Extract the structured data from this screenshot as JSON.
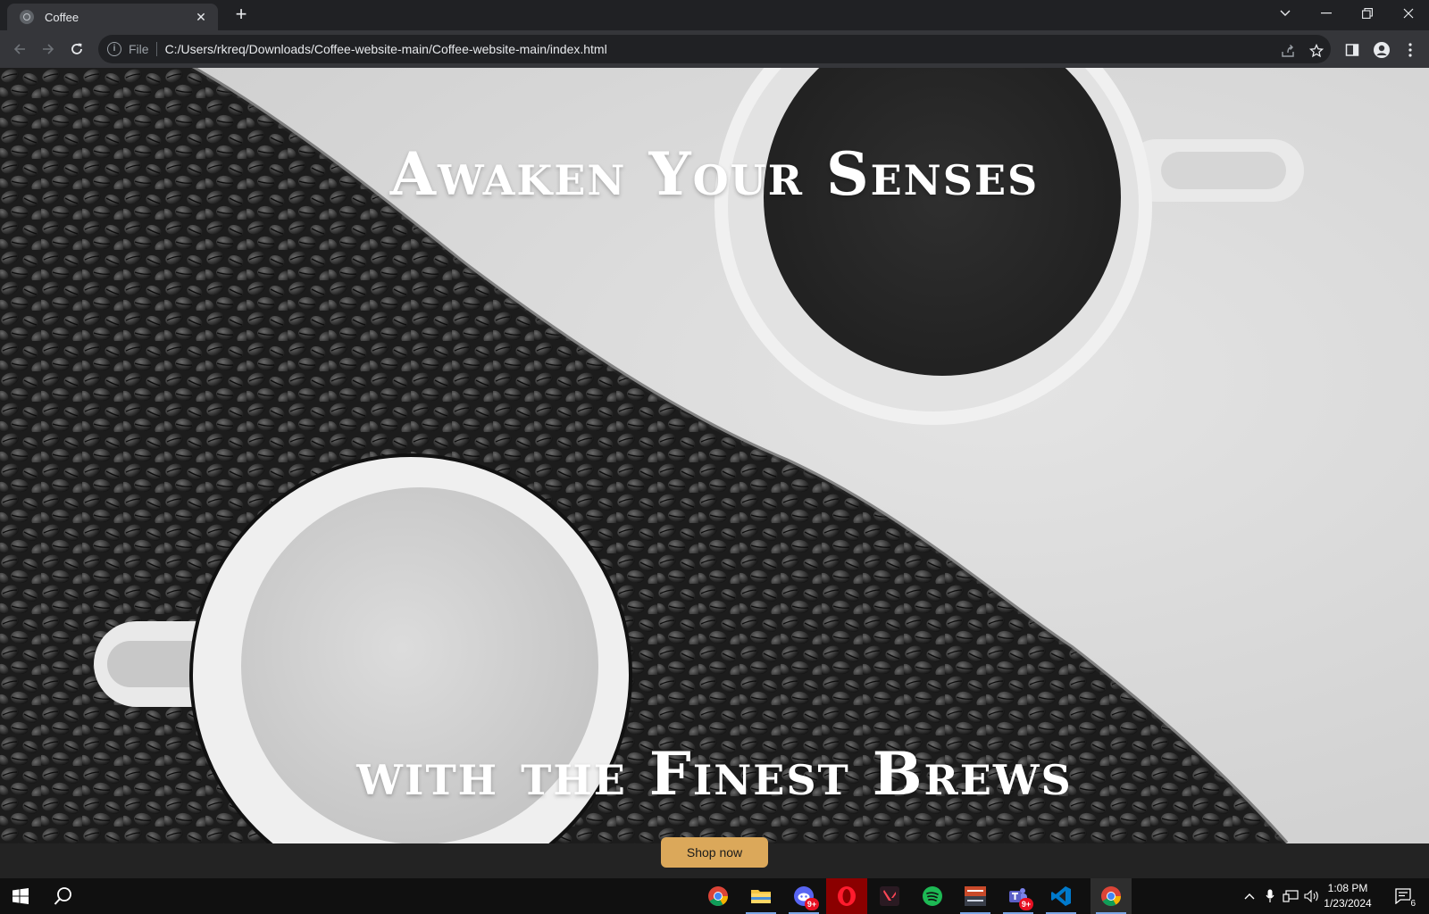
{
  "browser": {
    "tab_title": "Coffee",
    "tab_close": "✕",
    "new_tab": "+",
    "address_chip": "File",
    "url": "C:/Users/rkreq/Downloads/Coffee-website-main/Coffee-website-main/index.html"
  },
  "page": {
    "headline_top": "Awaken Your Senses",
    "headline_bottom": "with the Finest Brews",
    "shop_button": "Shop now"
  },
  "taskbar": {
    "apps": [
      {
        "name": "chrome",
        "color": "#4285f4"
      },
      {
        "name": "file-explorer",
        "color": "#f4c542"
      },
      {
        "name": "discord",
        "color": "#5865f2",
        "badge": "9+"
      },
      {
        "name": "opera",
        "color": "#ff1b2d"
      },
      {
        "name": "valorant",
        "color": "#ff4655"
      },
      {
        "name": "spotify",
        "color": "#1db954"
      },
      {
        "name": "voicemeeter",
        "color": "#c94a2a"
      },
      {
        "name": "teams",
        "color": "#5b5fc7",
        "badge": "9+"
      },
      {
        "name": "vscode",
        "color": "#007acc"
      },
      {
        "name": "chrome",
        "color": "#4285f4"
      }
    ],
    "time": "1:08 PM",
    "date": "1/23/2024",
    "notification_count": "6"
  }
}
